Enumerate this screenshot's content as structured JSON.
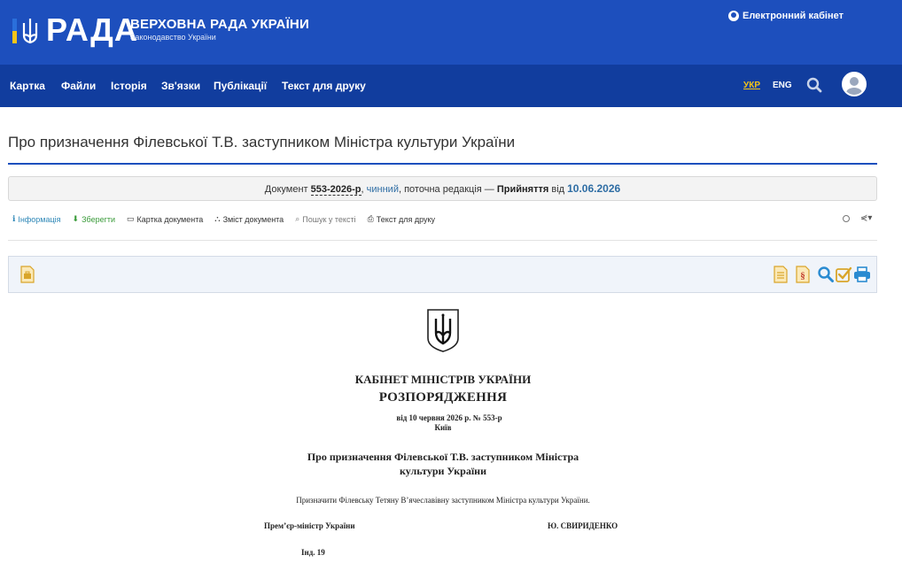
{
  "header": {
    "logo_text": "РАДА",
    "title": "ВЕРХОВНА РАДА УКРАЇНИ",
    "subtitle": "Законодавство України",
    "cabinet_label": "Електронний кабінет"
  },
  "nav": {
    "items": [
      "Картка",
      "Файли",
      "Історія",
      "Зв'язки",
      "Публікації",
      "Текст для друку"
    ],
    "lang_ukr": "УКР",
    "lang_eng": "ENG"
  },
  "doc": {
    "title": "Про призначення Філевської Т.В. заступником Міністра культури України",
    "status": {
      "prefix": "Документ",
      "number": "553-2026-р",
      "sep1": ",",
      "valid": "чинний",
      "mid": ", поточна редакція —",
      "adoption": "Прийняття",
      "from": "від",
      "date": "10.06.2026"
    }
  },
  "toolbar": {
    "info": "Інформація",
    "save": "Зберегти",
    "card": "Картка документа",
    "contents": "Зміст документа",
    "search": "Пошук у тексті",
    "print": "Текст для друку"
  },
  "body": {
    "org": "КАБІНЕТ МІНІСТРІВ УКРАЇНИ",
    "type": "РОЗПОРЯДЖЕННЯ",
    "date_line": "від 10 червня 2026 р. № 553-р",
    "city": "Київ",
    "heading_line1": "Про призначення Філевської Т.В. заступником Міністра",
    "heading_line2": "культури України",
    "text": "Призначити Філевську Тетяну В’ячеславівну заступником Міністра культури України.",
    "sign_position": "Прем’єр-міністр України",
    "sign_name": "Ю. СВИРИДЕНКО",
    "index": "Інд. 19"
  },
  "colors": {
    "header_blue": "#1d4fbd",
    "nav_blue": "#113d9e",
    "accent_yellow": "#f5c518"
  }
}
